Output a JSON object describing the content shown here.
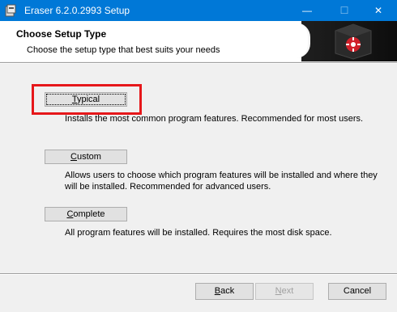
{
  "window": {
    "title": "Eraser 6.2.0.2993 Setup",
    "controls": {
      "minimize": "—",
      "maximize": "☐",
      "close": "✕"
    },
    "accent_color": "#0078d7"
  },
  "banner": {
    "title": "Choose Setup Type",
    "subtitle": "Choose the setup type that best suits your needs",
    "logo_icon": "eraser-logo-icon"
  },
  "options": [
    {
      "label_key": "T",
      "label_rest": "ypical",
      "description": "Installs the most common program features. Recommended for most users."
    },
    {
      "label_key": "C",
      "label_rest": "ustom",
      "description": "Allows users to choose which program features will be installed and where they will be installed. Recommended for advanced users."
    },
    {
      "label_key": "C",
      "label_rest": "omplete",
      "description": "All program features will be installed. Requires the most disk space."
    }
  ],
  "footer": {
    "back_key": "B",
    "back_rest": "ack",
    "next_key": "N",
    "next_rest": "ext",
    "cancel_label": "Cancel"
  },
  "highlight_color": "#e6171a"
}
